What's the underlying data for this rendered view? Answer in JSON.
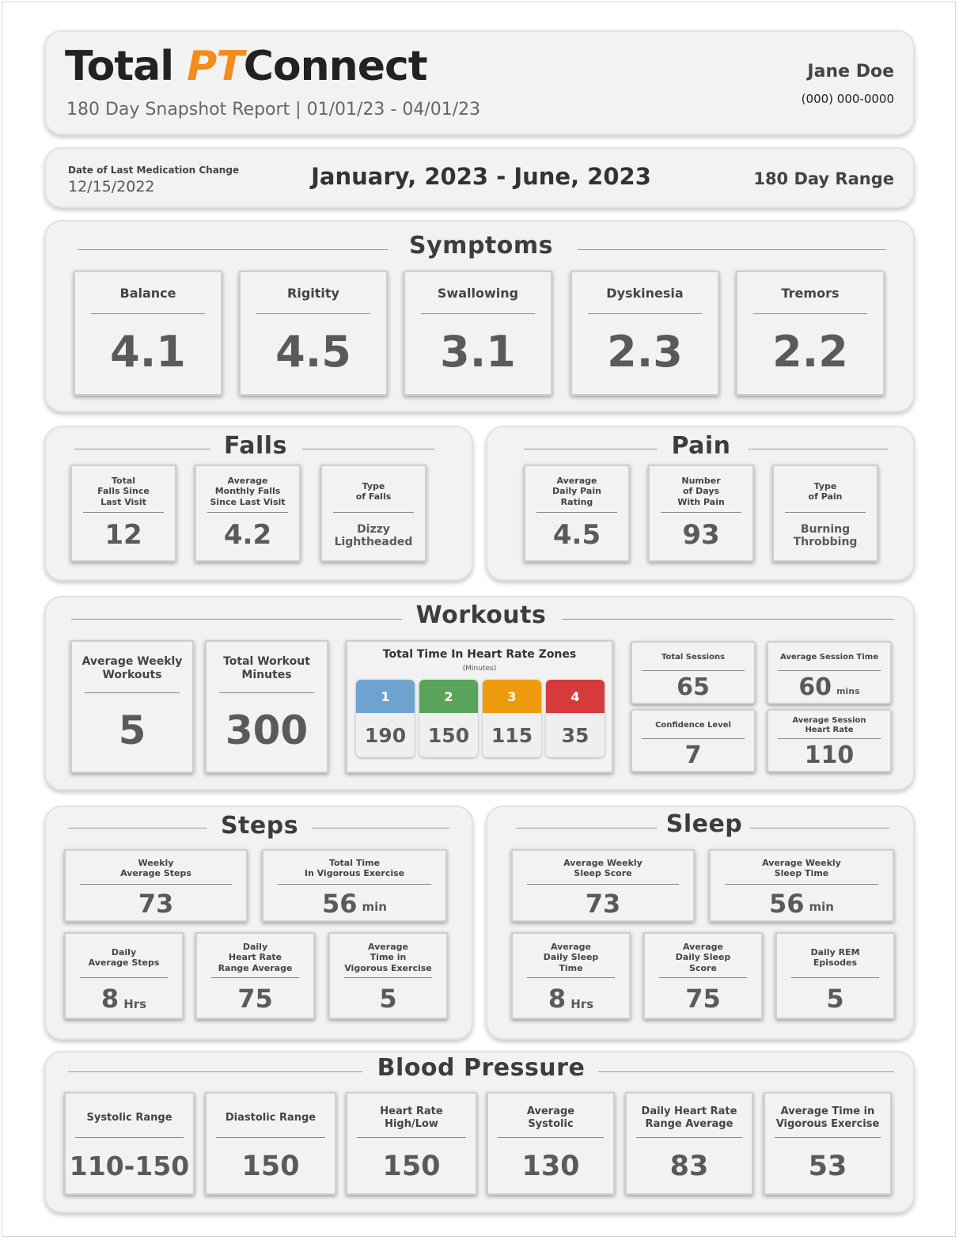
{
  "header": {
    "brand_part1": "Total",
    "brand_part2": "PT",
    "brand_part3": "Connect",
    "subtitle": "180 Day Snapshot Report | 01/01/23 - 04/01/23",
    "patient_name": "Jane Doe",
    "patient_phone": "(000) 000-0000",
    "accent_color": "#f28c1a"
  },
  "range_bar": {
    "med_change_label": "Date of Last Medication Change",
    "med_change_date": "12/15/2022",
    "date_range": "January, 2023 - June, 2023",
    "range_label": "180 Day Range"
  },
  "symptoms": {
    "title": "Symptoms",
    "cards": [
      {
        "label": "Balance",
        "value": "4.1"
      },
      {
        "label": "Rigitity",
        "value": "4.5"
      },
      {
        "label": "Swallowing",
        "value": "3.1"
      },
      {
        "label": "Dyskinesia",
        "value": "2.3"
      },
      {
        "label": "Tremors",
        "value": "2.2"
      }
    ]
  },
  "falls": {
    "title": "Falls",
    "cards": [
      {
        "label": "Total\nFalls Since\nLast Visit",
        "value": "12"
      },
      {
        "label": "Average\nMonthly Falls\nSince Last Visit",
        "value": "4.2"
      },
      {
        "label": "Type\nof Falls",
        "value": "Dizzy\nLightheaded"
      }
    ]
  },
  "pain": {
    "title": "Pain",
    "cards": [
      {
        "label": "Average\nDaily Pain\nRating",
        "value": "4.5"
      },
      {
        "label": "Number\nof Days\nWith Pain",
        "value": "93"
      },
      {
        "label": "Type\nof Pain",
        "value": "Burning\nThrobbing"
      }
    ]
  },
  "workouts": {
    "title": "Workouts",
    "weekly_label": "Average Weekly\nWorkouts",
    "weekly_value": "5",
    "minutes_label": "Total Workout\nMinutes",
    "minutes_value": "300",
    "zones_title": "Total Time In Heart Rate Zones",
    "zones_unit": "(Minutes)",
    "zones": [
      {
        "label": "1",
        "value": "190",
        "color": "#6fa3cf"
      },
      {
        "label": "2",
        "value": "150",
        "color": "#5aa35a"
      },
      {
        "label": "3",
        "value": "115",
        "color": "#ef9b0f"
      },
      {
        "label": "4",
        "value": "35",
        "color": "#d63a3a"
      }
    ],
    "sessions_label": "Total Sessions",
    "sessions_value": "65",
    "session_time_label": "Average Session Time",
    "session_time_value": "60",
    "session_time_unit": "mins",
    "confidence_label": "Confidence Level",
    "confidence_value": "7",
    "session_hr_label": "Average Session\nHeart Rate",
    "session_hr_value": "110"
  },
  "steps": {
    "title": "Steps",
    "cards": [
      {
        "label": "Weekly\nAverage Steps",
        "value": "73",
        "unit": ""
      },
      {
        "label": "Total Time\nIn Vigorous Exercise",
        "value": "56",
        "unit": "min"
      },
      {
        "label": "Daily\nAverage Steps",
        "value": "8",
        "unit": "Hrs"
      },
      {
        "label": "Daily\nHeart Rate\nRange Average",
        "value": "75",
        "unit": ""
      },
      {
        "label": "Average\nTime in\nVigorous Exercise",
        "value": "5",
        "unit": ""
      }
    ]
  },
  "sleep": {
    "title": "Sleep",
    "cards": [
      {
        "label": "Average Weekly\nSleep Score",
        "value": "73",
        "unit": ""
      },
      {
        "label": "Average Weekly\nSleep Time",
        "value": "56",
        "unit": "min"
      },
      {
        "label": "Average\nDaily Sleep\nTime",
        "value": "8",
        "unit": "Hrs"
      },
      {
        "label": "Average\nDaily Sleep\nScore",
        "value": "75",
        "unit": ""
      },
      {
        "label": "Daily REM\nEpisodes",
        "value": "5",
        "unit": ""
      }
    ]
  },
  "blood_pressure": {
    "title": "Blood Pressure",
    "cards": [
      {
        "label": "Systolic Range",
        "value": "110-150"
      },
      {
        "label": "Diastolic Range",
        "value": "150"
      },
      {
        "label": "Heart Rate\nHigh/Low",
        "value": "150"
      },
      {
        "label": "Average\nSystolic",
        "value": "130"
      },
      {
        "label": "Daily Heart Rate\nRange Average",
        "value": "83"
      },
      {
        "label": "Average Time in\nVigorous Exercise",
        "value": "53"
      }
    ]
  }
}
